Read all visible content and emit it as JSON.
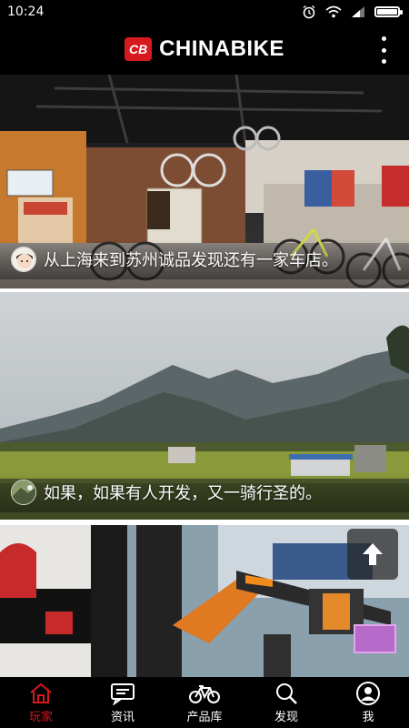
{
  "status": {
    "time": "10:24",
    "icons": [
      "alarm-icon",
      "wifi-icon",
      "signal-icon",
      "battery-icon"
    ],
    "battery_level": 0.9
  },
  "app": {
    "name": "CHINABIKE",
    "logo": "CB",
    "brand_color": "#d71920",
    "menu_icon": "more-vertical-icon"
  },
  "feed": {
    "items": [
      {
        "caption": "从上海来到苏州诚品发现还有一家车店。",
        "image": "bike shop interior"
      },
      {
        "caption": "如果，如果有人开发，又一骑行圣的。",
        "image": "mountain valley landscape"
      },
      {
        "caption": "",
        "image": "bicycle close-up with orange frame"
      }
    ]
  },
  "scroll_top_icon": "arrow-up-icon",
  "tabs": [
    {
      "label": "玩家",
      "icon": "home-icon",
      "active": true
    },
    {
      "label": "资讯",
      "icon": "news-icon",
      "active": false
    },
    {
      "label": "产品库",
      "icon": "bicycle-icon",
      "active": false
    },
    {
      "label": "发现",
      "icon": "search-icon",
      "active": false
    },
    {
      "label": "我",
      "icon": "user-icon",
      "active": false
    }
  ]
}
